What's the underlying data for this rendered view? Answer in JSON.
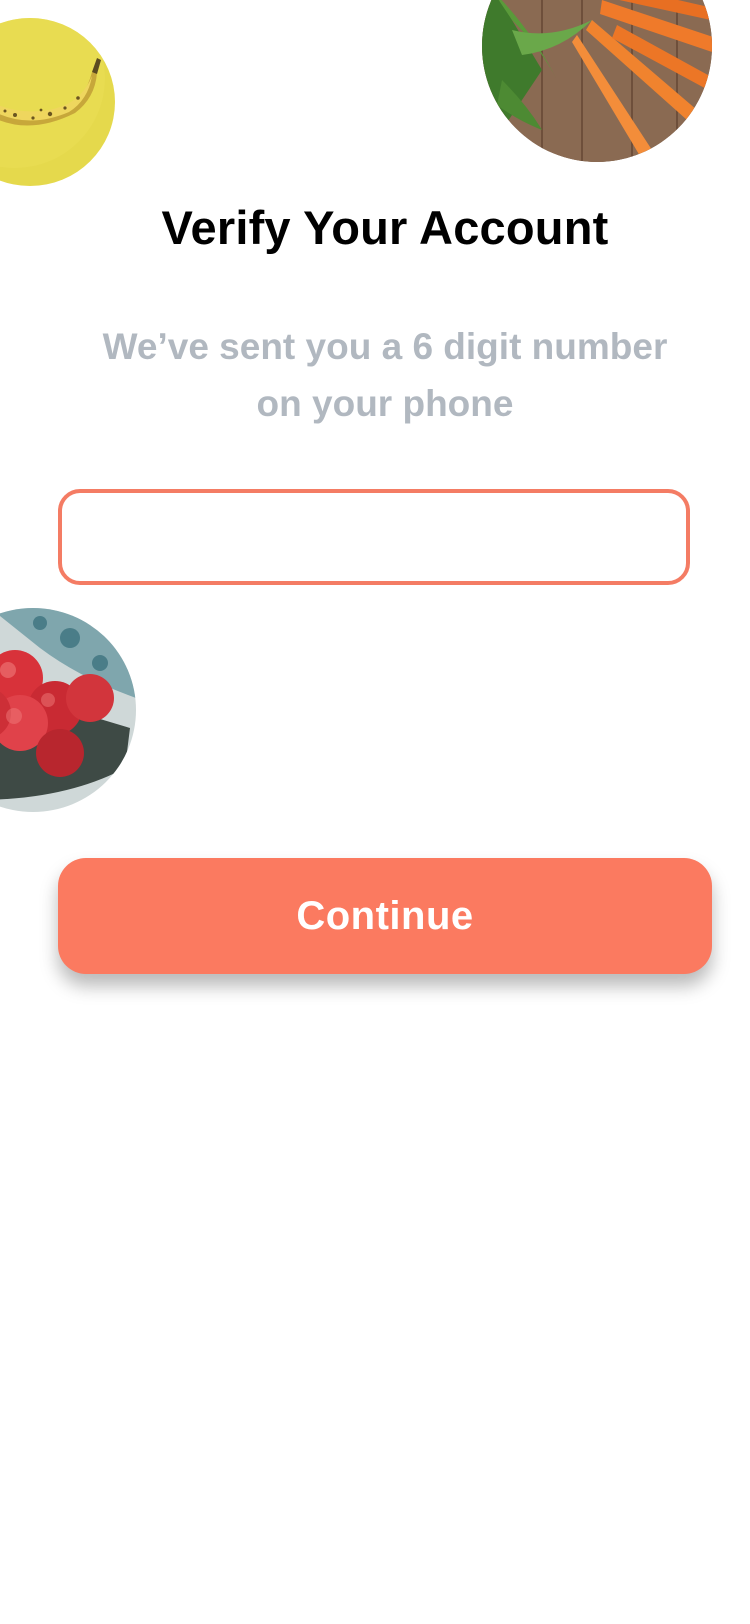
{
  "verify": {
    "title": "Verify Your Account",
    "subtitle": "We’ve sent you a 6 digit number on your phone",
    "code_input": {
      "value": "",
      "placeholder": ""
    },
    "continue_label": "Continue"
  },
  "decorations": [
    {
      "icon": "banana-image",
      "color": "#e5d94c"
    },
    {
      "icon": "carrots-image",
      "color": "#f07a2a"
    },
    {
      "icon": "apples-image",
      "color": "#d8323a"
    }
  ],
  "colors": {
    "accent": "#fb7a60",
    "input_border": "#f47c64",
    "subtitle": "#b1b8c0",
    "title": "#000000"
  }
}
